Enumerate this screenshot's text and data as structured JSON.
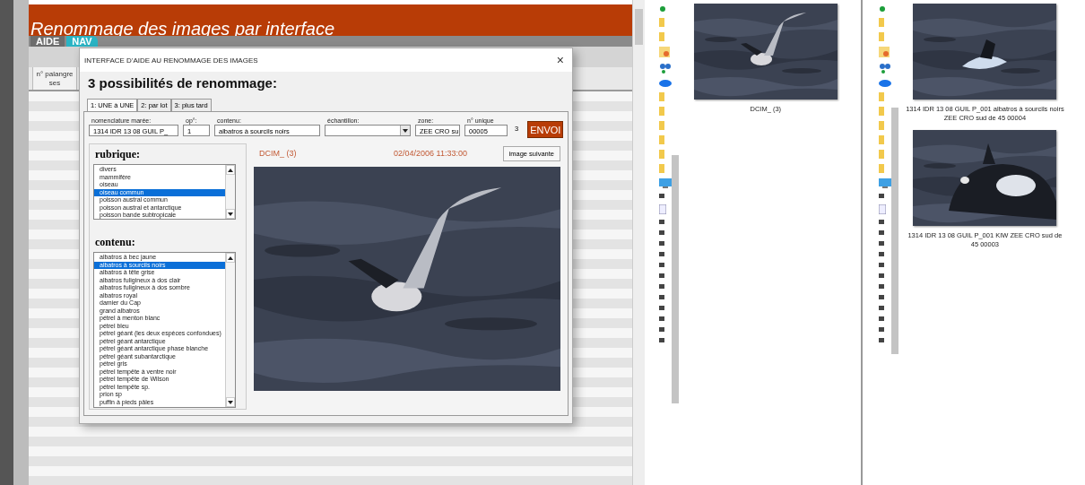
{
  "app": {
    "title": "Renommage des images par interface",
    "tabs": [
      {
        "label": "AIDE",
        "selected": false
      },
      {
        "label": "NAV",
        "selected": true
      }
    ],
    "header_lines": [
      "n° palangre",
      "ses"
    ]
  },
  "dialog": {
    "title": "INTERFACE D'AIDE AU RENOMMAGE DES IMAGES",
    "close": "×",
    "heading": "3 possibilités de renommage:",
    "tabs": [
      {
        "label": "1: UNE à UNE",
        "selected": true
      },
      {
        "label": "2:  par lot",
        "selected": false
      },
      {
        "label": "3:  plus tard",
        "selected": false
      }
    ],
    "fields": [
      {
        "kind": "text",
        "label": "nomenclature marée:",
        "value": "1314 IDR 13 08 GUIL P_"
      },
      {
        "kind": "text",
        "label": "op°:",
        "value": "1"
      },
      {
        "kind": "text",
        "label": "contenu:",
        "value": "albatros à sourcils noirs"
      },
      {
        "kind": "combo",
        "label": "échantillon:"
      },
      {
        "kind": "text",
        "label": "zone:",
        "value": "ZEE CRO su"
      },
      {
        "kind": "text",
        "label": "n° unique",
        "value": "00005"
      }
    ],
    "counter": "3",
    "send_button": "ENVOI",
    "rubrique": {
      "title": "rubrique:",
      "items": [
        {
          "label": "divers",
          "selected": false
        },
        {
          "label": "mammifère",
          "selected": false
        },
        {
          "label": "oiseau",
          "selected": false
        },
        {
          "label": "oiseau commun",
          "selected": true
        },
        {
          "label": "poisson austral commun",
          "selected": false
        },
        {
          "label": "poisson austral et antarctique",
          "selected": false
        },
        {
          "label": "poisson bande subtropicale",
          "selected": false
        }
      ]
    },
    "contenu": {
      "title": "contenu:",
      "items": [
        {
          "label": "albatros à bec jaune",
          "selected": false
        },
        {
          "label": "albatros à sourcils noirs",
          "selected": true
        },
        {
          "label": "albatros à tête grise",
          "selected": false
        },
        {
          "label": "albatros fuligineux à dos clair",
          "selected": false
        },
        {
          "label": "albatros fuligineux à dos sombre",
          "selected": false
        },
        {
          "label": "albatros royal",
          "selected": false
        },
        {
          "label": "damier du Cap",
          "selected": false
        },
        {
          "label": "grand albatros",
          "selected": false
        },
        {
          "label": "pétrel à menton blanc",
          "selected": false
        },
        {
          "label": "pétrel bleu",
          "selected": false
        },
        {
          "label": "pétrel géant (les deux espèces confondues)",
          "selected": false
        },
        {
          "label": "pétrel géant antarctique",
          "selected": false
        },
        {
          "label": "pétrel géant antarctique phase blanche",
          "selected": false
        },
        {
          "label": "pétrel géant subantarctique",
          "selected": false
        },
        {
          "label": "pétrel gris",
          "selected": false
        },
        {
          "label": "pétrel tempête à ventre noir",
          "selected": false
        },
        {
          "label": "pétrel tempête de Wilson",
          "selected": false
        },
        {
          "label": "pétrel tempête sp.",
          "selected": false
        },
        {
          "label": "prion sp",
          "selected": false
        },
        {
          "label": "puffin à pieds pâles",
          "selected": false
        }
      ]
    },
    "image": {
      "name": "DCIM_ (3)",
      "date": "02/04/2006 11:33:00",
      "next_button": "image suivante",
      "kind": "picture"
    }
  },
  "explorers": [
    {
      "files": [
        {
          "caption": "DCIM_ (3)",
          "kind": "picture"
        }
      ]
    },
    {
      "files": [
        {
          "caption": "1314 IDR 13 08 GUIL P_001 albatros à sourcils noirs  ZEE CRO sud de 45 00004",
          "kind": "picture"
        },
        {
          "caption": "1314 IDR 13 08 GUIL P_001 KIW  ZEE CRO sud de 45 00003",
          "kind": "picture"
        }
      ]
    }
  ]
}
